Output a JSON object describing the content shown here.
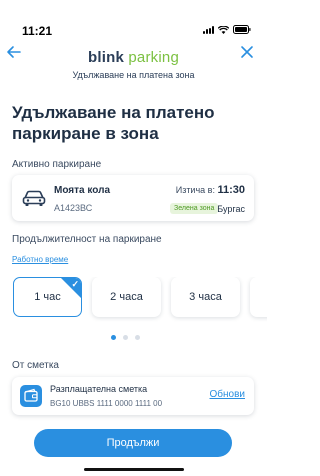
{
  "status_bar": {
    "time": "11:21"
  },
  "header": {
    "logo_part1": "blink",
    "logo_part2": "parking",
    "subtitle": "Удължаване на платена зона"
  },
  "page_title": "Удължаване на платено паркиране в зона",
  "active_parking": {
    "label": "Активно паркиране",
    "car_name": "Моята кола",
    "plate": "А1423ВС",
    "expires_label": "Изтича в:",
    "expires_time": "11:30",
    "zone": "Зелена зона",
    "city": "Бургас"
  },
  "duration": {
    "label": "Продължителност на паркиране",
    "working_hours_link": "Работно време",
    "options": [
      "1 час",
      "2 часа",
      "3 часа"
    ],
    "selected_index": 0
  },
  "account": {
    "label": "От сметка",
    "name": "Разплащателна сметка",
    "iban": "BG10 UBBS 1111 0000 1111 00",
    "update_link": "Обнови"
  },
  "cta_label": "Продължи",
  "colors": {
    "accent": "#2a8fe0",
    "text_dark": "#1f2f44",
    "brand_green": "#7cc142",
    "zone_green": "#4e9a23"
  }
}
